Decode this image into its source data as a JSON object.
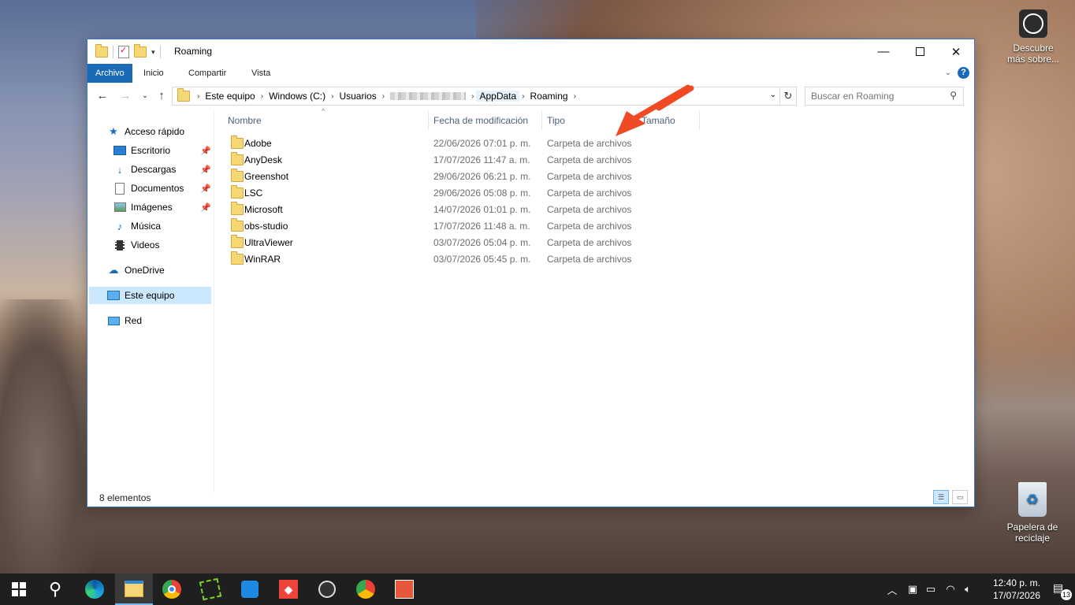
{
  "window": {
    "title": "Roaming"
  },
  "ribbon": {
    "tabs": [
      "Archivo",
      "Inicio",
      "Compartir",
      "Vista"
    ]
  },
  "address_bar": {
    "crumbs": [
      "Este equipo",
      "Windows (C:)",
      "Usuarios",
      "AppData",
      "Roaming"
    ]
  },
  "search": {
    "placeholder": "Buscar en Roaming"
  },
  "sidebar": {
    "quick_access": "Acceso rápido",
    "pinned": [
      {
        "label": "Escritorio",
        "icon": "desktop-icon"
      },
      {
        "label": "Descargas",
        "icon": "download-icon"
      },
      {
        "label": "Documentos",
        "icon": "document-icon"
      },
      {
        "label": "Imágenes",
        "icon": "image-icon"
      }
    ],
    "music": "Música",
    "videos": "Videos",
    "onedrive": "OneDrive",
    "this_pc": "Este equipo",
    "network": "Red"
  },
  "columns": {
    "name": "Nombre",
    "modified": "Fecha de modificación",
    "type": "Tipo",
    "size": "Tamaño"
  },
  "files": [
    {
      "name": "Adobe",
      "modified": "22/06/2026 07:01 p. m.",
      "type": "Carpeta de archivos"
    },
    {
      "name": "AnyDesk",
      "modified": "17/07/2026 11:47 a. m.",
      "type": "Carpeta de archivos"
    },
    {
      "name": "Greenshot",
      "modified": "29/06/2026 06:21 p. m.",
      "type": "Carpeta de archivos"
    },
    {
      "name": "LSC",
      "modified": "29/06/2026 05:08 p. m.",
      "type": "Carpeta de archivos"
    },
    {
      "name": "Microsoft",
      "modified": "14/07/2026 01:01 p. m.",
      "type": "Carpeta de archivos"
    },
    {
      "name": "obs-studio",
      "modified": "17/07/2026 11:48 a. m.",
      "type": "Carpeta de archivos"
    },
    {
      "name": "UltraViewer",
      "modified": "03/07/2026 05:04 p. m.",
      "type": "Carpeta de archivos"
    },
    {
      "name": "WinRAR",
      "modified": "03/07/2026 05:45 p. m.",
      "type": "Carpeta de archivos"
    }
  ],
  "status": {
    "count": "8 elementos"
  },
  "desktop": {
    "discover_label": "Descubre más sobre...",
    "recycle_label": "Papelera de reciclaje"
  },
  "taskbar": {
    "time": "12:40 p. m.",
    "date": "17/07/2026",
    "notifications": "13"
  },
  "colors": {
    "accent": "#1a6ab8",
    "arrow": "#f04a24",
    "selection": "#cce8ff",
    "taskbar": "#1f1f1f"
  }
}
